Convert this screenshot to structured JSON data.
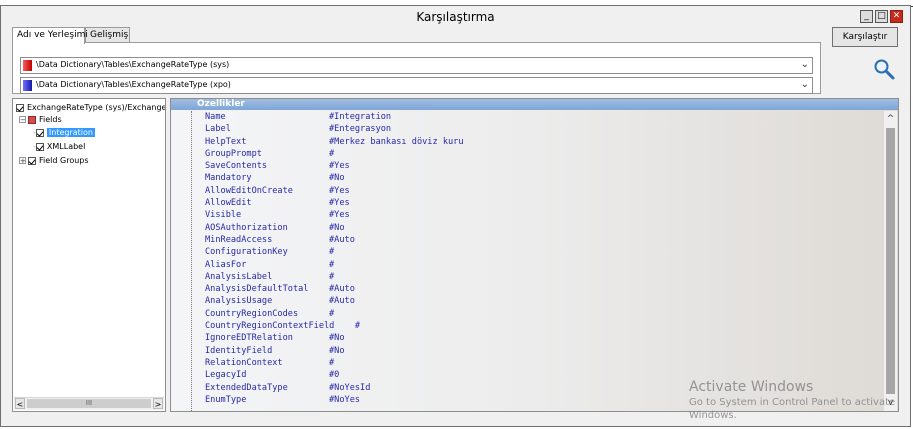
{
  "window": {
    "title": "Karşılaştırma",
    "controls": {
      "minimize": "_",
      "maximize": "□",
      "close": "✕"
    }
  },
  "tabs": [
    {
      "label": "Adı ve Yerleşimi",
      "active": true
    },
    {
      "label": "Gelişmiş",
      "active": false
    }
  ],
  "paths": [
    {
      "value": "\\Data Dictionary\\Tables\\ExchangeRateType (sys)",
      "color": "#e02020"
    },
    {
      "value": "\\Data Dictionary\\Tables\\ExchangeRateType (xpo)",
      "color": "#3535d0"
    }
  ],
  "compare_button": {
    "label": "Karşılaştır"
  },
  "tree": {
    "root": "ExchangeRateType (sys)/Exchange",
    "fields": "Fields",
    "integration": "Integration",
    "xmllabel": "XMLLabel",
    "field_groups": "Field Groups",
    "expand_glyph": "−",
    "collapsed_glyph": "+",
    "scroll_thumb_glyph": "III",
    "scroll_left": "<",
    "scroll_right": ">"
  },
  "properties": {
    "header": "Özellikler",
    "scroll_up": "^",
    "scroll_down": "v",
    "rows": [
      {
        "name": "Name",
        "value": "#Integration"
      },
      {
        "name": "Label",
        "value": "#Entegrasyon"
      },
      {
        "name": "HelpText",
        "value": "#Merkez bankası döviz kuru"
      },
      {
        "name": "GroupPrompt",
        "value": "#"
      },
      {
        "name": "SaveContents",
        "value": "#Yes"
      },
      {
        "name": "Mandatory",
        "value": "#No"
      },
      {
        "name": "AllowEditOnCreate",
        "value": "#Yes"
      },
      {
        "name": "AllowEdit",
        "value": "#Yes"
      },
      {
        "name": "Visible",
        "value": "#Yes"
      },
      {
        "name": "AOSAuthorization",
        "value": "#No"
      },
      {
        "name": "MinReadAccess",
        "value": "#Auto"
      },
      {
        "name": "ConfigurationKey",
        "value": "#"
      },
      {
        "name": "AliasFor",
        "value": "#"
      },
      {
        "name": "AnalysisLabel",
        "value": "#"
      },
      {
        "name": "AnalysisDefaultTotal",
        "value": "#Auto"
      },
      {
        "name": "AnalysisUsage",
        "value": "#Auto"
      },
      {
        "name": "CountryRegionCodes",
        "value": "#"
      },
      {
        "name": "CountryRegionContextField",
        "value": "     #"
      },
      {
        "name": "IgnoreEDTRelation",
        "value": "#No"
      },
      {
        "name": "IdentityField",
        "value": "#No"
      },
      {
        "name": "RelationContext",
        "value": "#"
      },
      {
        "name": "LegacyId",
        "value": "#0"
      },
      {
        "name": "ExtendedDataType",
        "value": "#NoYesId"
      },
      {
        "name": "EnumType",
        "value": "#NoYes"
      }
    ]
  },
  "watermark": {
    "line1": "Activate Windows",
    "line2": "Go to System in Control Panel to activate",
    "line3": "Windows."
  },
  "icons": {
    "search": "magnifier-icon"
  }
}
